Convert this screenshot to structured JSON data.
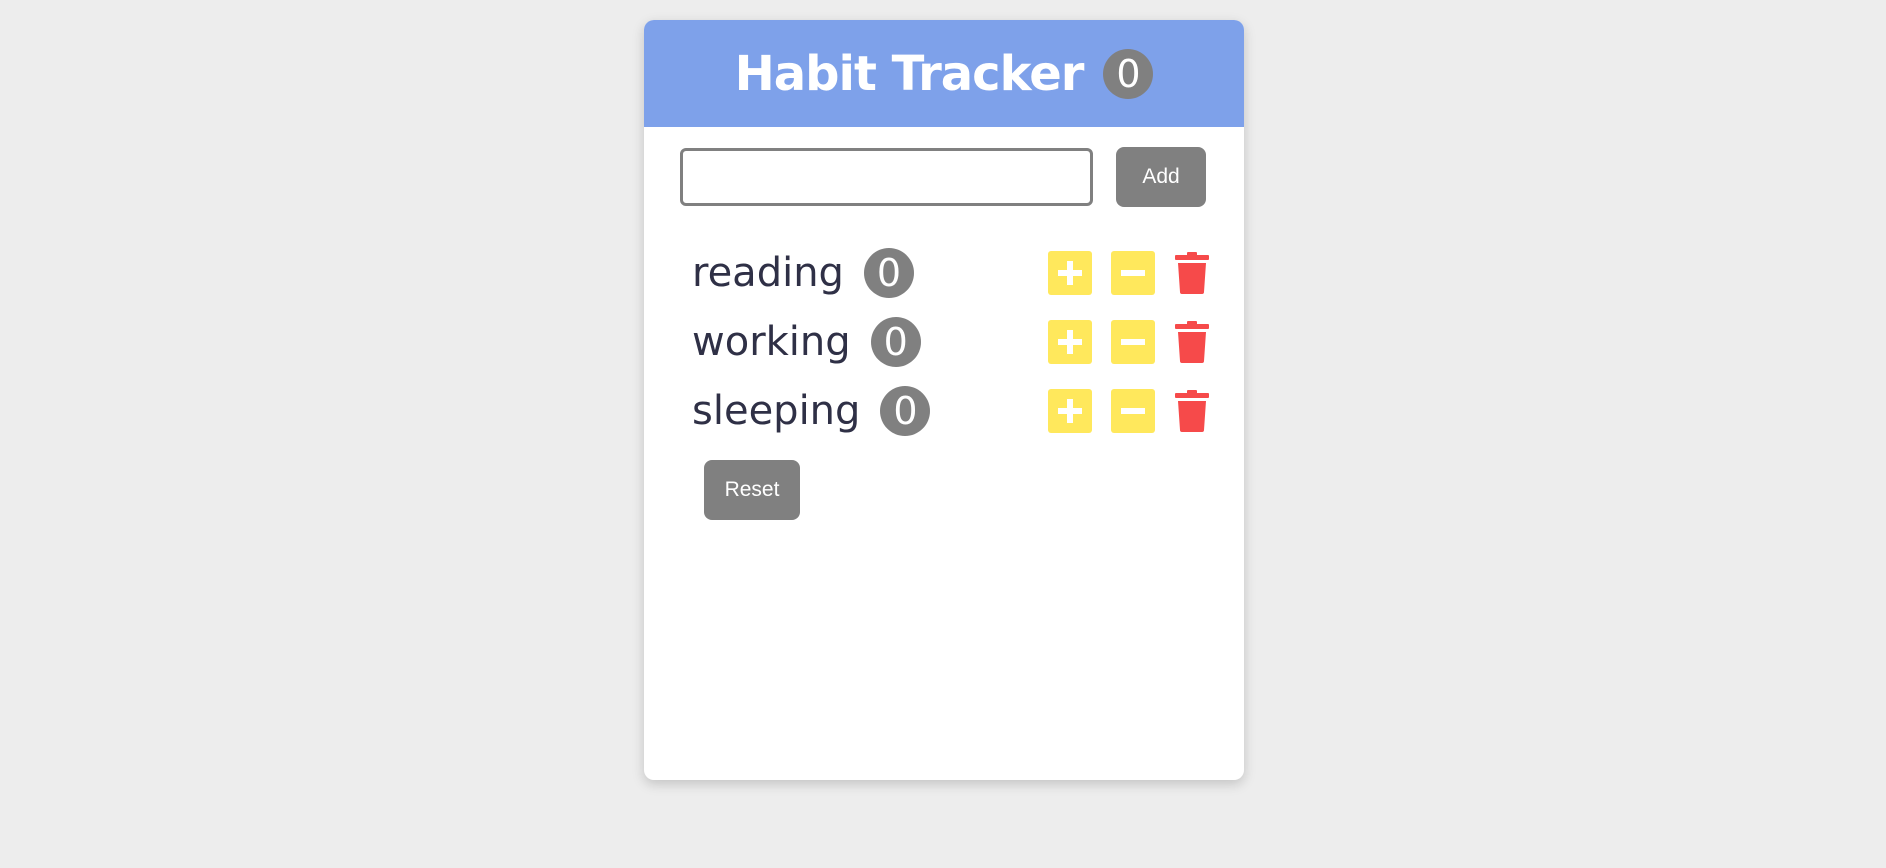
{
  "header": {
    "title": "Habit Tracker",
    "total_count": "0"
  },
  "add_form": {
    "input_value": "",
    "placeholder": "",
    "add_label": "Add"
  },
  "habits": [
    {
      "name": "reading",
      "count": "0"
    },
    {
      "name": "working",
      "count": "0"
    },
    {
      "name": "sleeping",
      "count": "0"
    }
  ],
  "reset_label": "Reset",
  "icons": {
    "increment": "plus-icon",
    "decrement": "minus-icon",
    "delete": "trash-icon"
  },
  "colors": {
    "header_bg": "#7ea1ea",
    "badge_bg": "#808080",
    "control_bg": "#ffe85c",
    "delete_color": "#f64a4a",
    "page_bg": "#ededed",
    "habit_text": "#2f3046"
  }
}
